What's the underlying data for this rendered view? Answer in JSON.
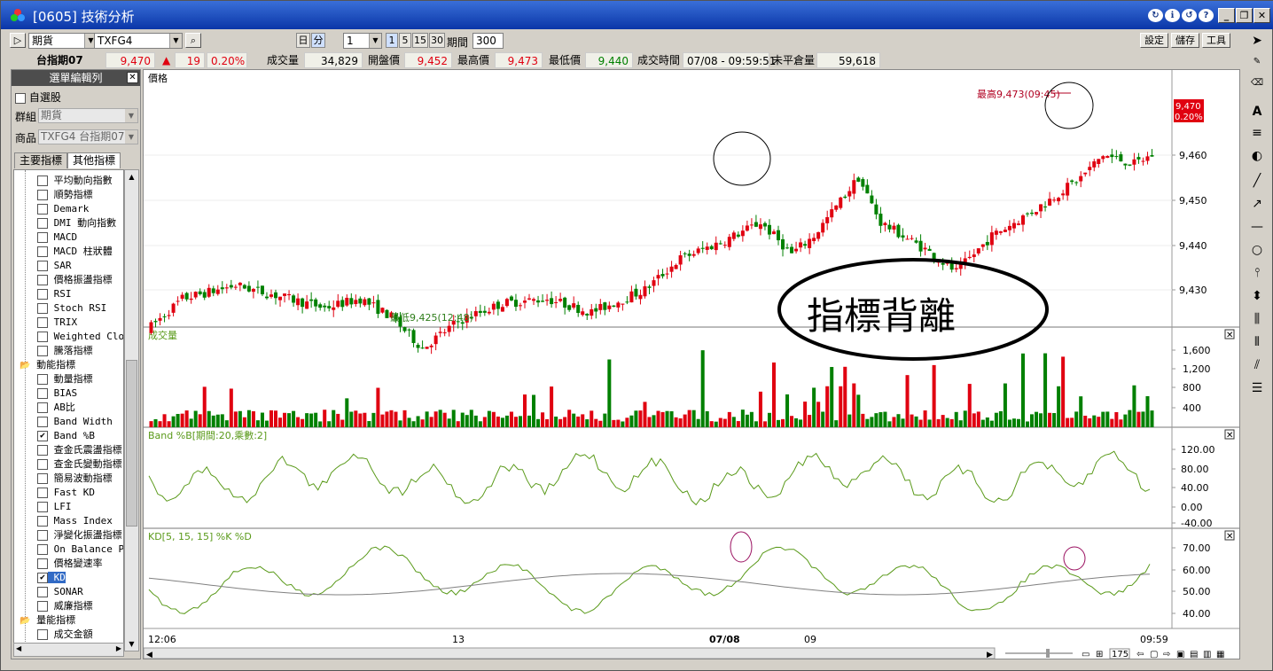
{
  "window": {
    "title": "[0605] 技術分析",
    "top_buttons": [
      "↻",
      "ℹ",
      "↺",
      "?"
    ],
    "controls": [
      "_",
      "❐",
      "✕"
    ]
  },
  "toolbar": {
    "market": "期貨",
    "symbol": "TXFG4",
    "period_buttons": [
      "日",
      "分"
    ],
    "interval": "1",
    "mins": [
      "1",
      "5",
      "15",
      "30"
    ],
    "period_label": "期間",
    "period_value": "300",
    "right_buttons": [
      "設定",
      "儲存",
      "工具"
    ]
  },
  "quote": {
    "name": "台指期07",
    "price": "9,470",
    "change_icon": "▲",
    "change": "19",
    "pct": "0.20%",
    "volume_label": "成交量",
    "volume": "34,829",
    "open_label": "開盤價",
    "open": "9,452",
    "high_label": "最高價",
    "high": "9,473",
    "low_label": "最低價",
    "low": "9,440",
    "time_label": "成交時間",
    "time": "07/08 - 09:59:51",
    "oi_label": "未平倉量",
    "oi": "59,618"
  },
  "left_panel": {
    "title": "選單編輯列",
    "watchlist": "自選股",
    "group_label": "群組",
    "group_value": "期貨",
    "product_label": "商品",
    "product_value": "TXFG4 台指期07",
    "tabs": [
      "主要指標",
      "其他指標"
    ],
    "tree": [
      {
        "label": "平均動向指數",
        "type": "item",
        "checked": false
      },
      {
        "label": "順勢指標",
        "type": "item",
        "checked": false
      },
      {
        "label": "Demark",
        "type": "item",
        "checked": false
      },
      {
        "label": "DMI 動向指數",
        "type": "item",
        "checked": false
      },
      {
        "label": "MACD",
        "type": "item",
        "checked": false
      },
      {
        "label": "MACD 柱狀體",
        "type": "item",
        "checked": false
      },
      {
        "label": "SAR",
        "type": "item",
        "checked": false
      },
      {
        "label": "價格振盪指標",
        "type": "item",
        "checked": false
      },
      {
        "label": "RSI",
        "type": "item",
        "checked": false
      },
      {
        "label": "Stoch RSI",
        "type": "item",
        "checked": false
      },
      {
        "label": "TRIX",
        "type": "item",
        "checked": false
      },
      {
        "label": "Weighted Clos",
        "type": "item",
        "checked": false
      },
      {
        "label": "騰落指標",
        "type": "item",
        "checked": false
      },
      {
        "label": "動能指標",
        "type": "folder",
        "checked": false
      },
      {
        "label": "動量指標",
        "type": "item",
        "checked": false
      },
      {
        "label": "BIAS",
        "type": "item",
        "checked": false
      },
      {
        "label": "AB比",
        "type": "item",
        "checked": false
      },
      {
        "label": "Band Width",
        "type": "item",
        "checked": false
      },
      {
        "label": "Band %B",
        "type": "item",
        "checked": true
      },
      {
        "label": "查金氏震盪指標",
        "type": "item",
        "checked": false
      },
      {
        "label": "查金氏變動指標",
        "type": "item",
        "checked": false
      },
      {
        "label": "簡易波動指標",
        "type": "item",
        "checked": false
      },
      {
        "label": "Fast KD",
        "type": "item",
        "checked": false
      },
      {
        "label": "LFI",
        "type": "item",
        "checked": false
      },
      {
        "label": "Mass Index",
        "type": "item",
        "checked": false
      },
      {
        "label": "淨變化振盪指標",
        "type": "item",
        "checked": false
      },
      {
        "label": "On Balance Pr",
        "type": "item",
        "checked": false
      },
      {
        "label": "價格變速率",
        "type": "item",
        "checked": false
      },
      {
        "label": "KD",
        "type": "item",
        "checked": true,
        "selected": true
      },
      {
        "label": "SONAR",
        "type": "item",
        "checked": false
      },
      {
        "label": "威廉指標",
        "type": "item",
        "checked": false
      },
      {
        "label": "量能指標",
        "type": "folder",
        "checked": false
      },
      {
        "label": "成交金額",
        "type": "item",
        "checked": false
      }
    ]
  },
  "panes": {
    "price": {
      "label": "價格",
      "y_ticks": [
        "9,460",
        "9,450",
        "9,440",
        "9,430"
      ],
      "last_price": "9,470",
      "last_pct": "0.20%",
      "high_annotation": "最高9,473(09:45)",
      "low_annotation": "最低9,425(12:48)",
      "handwriting": "指標背離"
    },
    "volume": {
      "label": "成交量",
      "y_ticks": [
        "1,600",
        "1,200",
        "800",
        "400"
      ]
    },
    "band": {
      "label": "Band %B[期間:20,乘數:2]",
      "y_ticks": [
        "120.00",
        "80.00",
        "40.00",
        "0.00",
        "-40.00"
      ]
    },
    "kd": {
      "label": "KD[5, 15, 15] %K %D",
      "y_ticks": [
        "70.00",
        "60.00",
        "50.00",
        "40.00"
      ]
    }
  },
  "x_axis": {
    "labels": [
      "12:06",
      "13",
      "07/08",
      "09",
      "09:59"
    ]
  },
  "bottom": {
    "zoom": "175"
  },
  "colors": {
    "up": "#e00010",
    "down": "#008000",
    "line_band": "#5a9a1a",
    "line_d": "#808080",
    "annotation": "#b00020",
    "low_annotation": "#2e7d1a"
  }
}
